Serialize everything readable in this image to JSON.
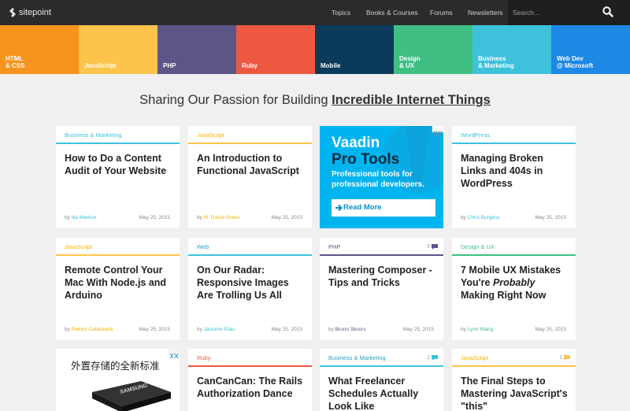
{
  "nav": {
    "logo": "sitepoint",
    "links": [
      "Topics",
      "Books & Courses",
      "Forums",
      "Newsletters"
    ],
    "search_placeholder": "Search..."
  },
  "categories": [
    {
      "label": "HTML\n& CSS",
      "color": "#f7941d"
    },
    {
      "label": "JavaScript",
      "color": "#fcc44b"
    },
    {
      "label": "PHP",
      "color": "#5c5687"
    },
    {
      "label": "Ruby",
      "color": "#ef5840"
    },
    {
      "label": "Mobile",
      "color": "#0b3b5b"
    },
    {
      "label": "Design\n& UX",
      "color": "#3fbf84"
    },
    {
      "label": "Business\n& Marketing",
      "color": "#3ec2dc"
    },
    {
      "label": "Web Dev\n@ Microsoft",
      "color": "#1e88e5"
    }
  ],
  "headline": {
    "prefix": "Sharing Our Passion for Building ",
    "emphasis": "Incredible Internet Things"
  },
  "cards": [
    {
      "category": "Business & Marketing",
      "color": "#3ec2dc",
      "title": "How to Do a Content Audit of Your Website",
      "author": "Ilia Markov",
      "date": "May 25, 2015",
      "comments": ""
    },
    {
      "category": "JavaScript",
      "color": "#fcc44b",
      "title": "An Introduction to Functional JavaScript",
      "author": "M. David Green",
      "date": "May 25, 2015",
      "comments": ""
    },
    {
      "category": "WordPress",
      "color": "#3ec2dc",
      "title": "Managing Broken Links and 404s in WordPress",
      "author": "Chris Burgess",
      "date": "May 25, 2015",
      "comments": ""
    },
    {
      "category": "JavaScript",
      "color": "#fcc44b",
      "title": "Remote Control Your Mac With Node.js and Arduino",
      "author": "Patrick Catanzariti",
      "date": "May 25, 2015",
      "comments": ""
    },
    {
      "category": "Web",
      "color": "#3ec2dc",
      "title": "On Our Radar: Responsive Images Are Trolling Us All",
      "author": "Jasmine Elias",
      "date": "May 25, 2015",
      "comments": ""
    },
    {
      "category": "PHP",
      "color": "#5c5687",
      "title": "Mastering Composer - Tips and Tricks",
      "author": "Bruno Skvorc",
      "date": "May 25, 2015",
      "comments": "5"
    },
    {
      "category": "Design & UX",
      "color": "#3fbf84",
      "title_pre": "7 Mobile UX Mistakes You're ",
      "title_em": "Probably",
      "title_post": " Making Right Now",
      "author": "Lynn Wang",
      "date": "May 25, 2015",
      "comments": ""
    },
    {
      "category": "Ruby",
      "color": "#ef5840",
      "title": "CanCanCan: The Rails Authorization Dance",
      "author": "",
      "date": "",
      "comments": ""
    },
    {
      "category": "Business & Marketing",
      "color": "#3ec2dc",
      "title": "What Freelancer Schedules Actually Look Like",
      "author": "",
      "date": "",
      "comments": "2"
    },
    {
      "category": "JavaScript",
      "color": "#fcc44b",
      "title": "The Final Steps to Mastering JavaScript's \"this\"",
      "author": "",
      "date": "",
      "comments": "1"
    }
  ],
  "by_prefix": "by ",
  "ads": {
    "vaadin": {
      "brand": "Vaadin",
      "product": "Pro Tools",
      "copy": "Professional tools for professional developers.",
      "cta": "Read More"
    },
    "samsung": {
      "copy": "外置存储的全新标准",
      "logo_text": "SAMSUNG"
    }
  }
}
